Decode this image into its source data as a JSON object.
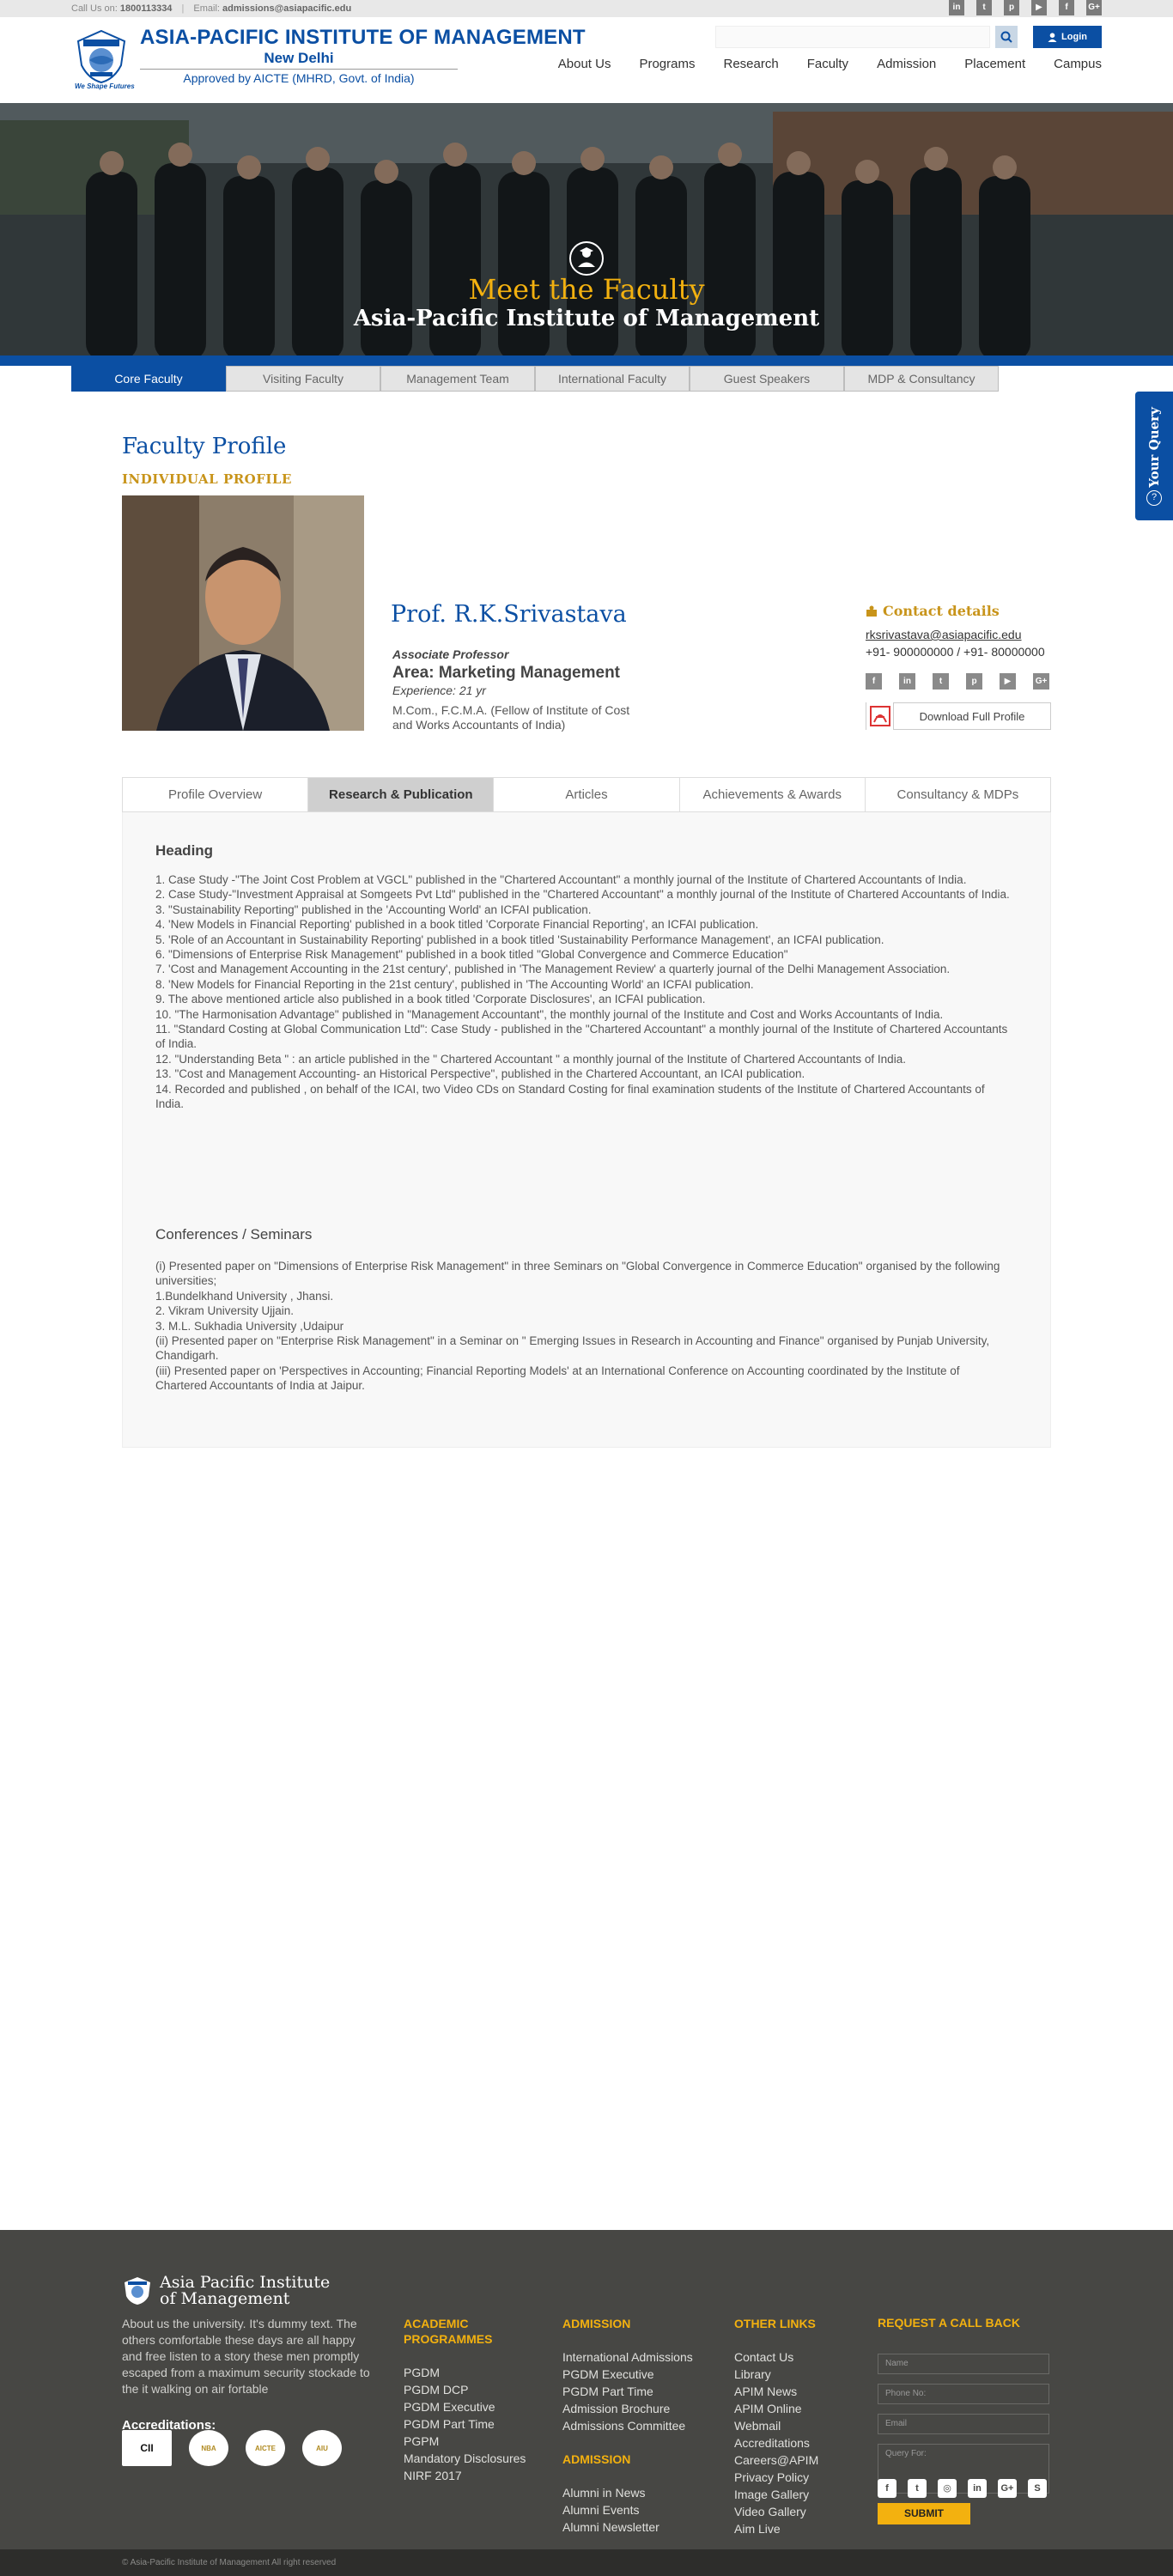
{
  "topbar": {
    "call_label": "Call Us on:",
    "call_number": "1800113334",
    "separator": "|",
    "email_label": "Email:",
    "email": "admissions@asiapacific.edu",
    "social": [
      "in",
      "t",
      "p",
      "yt",
      "f",
      "G+"
    ]
  },
  "header": {
    "title": "ASIA-PACIFIC INSTITUTE OF MANAGEMENT",
    "city": "New Delhi",
    "approved": "Approved by AICTE (MHRD, Govt. of India)",
    "tagline": "We Shape Futures",
    "login": "Login",
    "nav": [
      "About Us",
      "Programs",
      "Research",
      "Faculty",
      "Admission",
      "Placement",
      "Campus"
    ]
  },
  "hero": {
    "title": "Meet the Faculty",
    "subtitle": "Asia-Pacific Institute of Management"
  },
  "faculty_tabs": [
    "Core Faculty",
    "Visiting Faculty",
    "Management Team",
    "International Faculty",
    "Guest Speakers",
    "MDP & Consultancy"
  ],
  "query_label": "Your Query",
  "profile": {
    "heading": "Faculty Profile",
    "subheading": "INDIVIDUAL PROFILE",
    "name": "Prof. R.K.Srivastava",
    "designation": "Associate Professor",
    "area": "Area: Marketing Management",
    "experience": "Experience: 21 yr",
    "qualification": "M.Com., F.C.M.A. (Fellow of Institute of Cost and Works Accountants of India)",
    "contact_heading": "Contact details",
    "email": "rksrivastava@asiapacific.edu",
    "phone": "+91- 900000000 / +91- 80000000",
    "social": [
      "f",
      "in",
      "t",
      "p",
      "yt",
      "G+"
    ],
    "download": "Download Full Profile"
  },
  "profile_tabs": [
    "Profile Overview",
    "Research & Publication",
    "Articles",
    "Achievements & Awards",
    "Consultancy & MDPs"
  ],
  "content": {
    "heading": "Heading",
    "publications": [
      "1. Case Study -\"The Joint Cost Problem at VGCL\" published in the \"Chartered Accountant\" a monthly journal of the Institute of Chartered Accountants of India.",
      "2. Case Study-\"Investment Appraisal at Somgeets Pvt Ltd\" published in the \"Chartered Accountant\" a monthly journal of the Institute of Chartered Accountants of India.",
      "3. \"Sustainability Reporting\" published in the 'Accounting World' an ICFAI publication.",
      "4. 'New Models in Financial Reporting' published in a book titled 'Corporate Financial Reporting', an ICFAI publication.",
      "5. 'Role of an Accountant in Sustainability Reporting' published in a book titled 'Sustainability Performance Management', an ICFAI publication.",
      "6. \"Dimensions of Enterprise Risk Management\" published in a book titled \"Global Convergence and Commerce Education\"",
      "7. 'Cost and Management Accounting in the 21st century', published in 'The Management Review' a quarterly journal of the Delhi Management Association.",
      "8. 'New Models for Financial Reporting in the 21st century', published in 'The Accounting World' an ICFAI publication.",
      "9. The above mentioned article also published in a book titled 'Corporate Disclosures', an ICFAI publication.",
      "10. \"The Harmonisation Advantage\" published in \"Management Accountant\", the monthly journal of the Institute and Cost and Works Accountants of India.",
      "11. \"Standard Costing at Global Communication Ltd\": Case Study - published in the \"Chartered Accountant\" a monthly journal of the Institute of Chartered Accountants of India.",
      "12. \"Understanding Beta \" : an article published in the \" Chartered Accountant \" a monthly journal of the Institute of Chartered Accountants of India.",
      "13. \"Cost and Management Accounting- an Historical Perspective\", published in the Chartered Accountant, an ICAI publication.",
      "14. Recorded and published , on behalf of the ICAI, two Video CDs on Standard Costing for final examination students of the Institute of Chartered Accountants of India."
    ],
    "conferences_heading": "Conferences / Seminars",
    "conferences": [
      "(i) Presented paper on \"Dimensions of Enterprise Risk Management\" in three Seminars on \"Global Convergence in Commerce Education\" organised by the following universities;",
      "1.Bundelkhand University , Jhansi.",
      "2. Vikram University Ujjain.",
      "3. M.L. Sukhadia University ,Udaipur",
      "(ii) Presented paper on \"Enterprise Risk Management\" in a Seminar on \" Emerging Issues in Research in Accounting and Finance\" organised by Punjab University, Chandigarh.",
      "(iii) Presented paper on 'Perspectives in Accounting; Financial Reporting Models' at an International Conference on Accounting coordinated by the Institute of Chartered Accountants of India at Jaipur."
    ]
  },
  "footer": {
    "logo_line1": "Asia Pacific Institute",
    "logo_line2": "of Management",
    "about": "About us the university. It's dummy text. The others comfortable these days are all happy and free listen to a story these men promptly escaped from a maximum security stockade to the it walking on air fortable",
    "accreditations_label": "Accreditations:",
    "accreditations": [
      "CII",
      "NBA",
      "AICTE",
      "AIU"
    ],
    "academic_heading": "ACADEMIC PROGRAMMES",
    "academic": [
      "PGDM",
      "PGDM DCP",
      "PGDM Executive",
      "PGDM Part Time",
      "PGPM",
      "Mandatory Disclosures",
      "NIRF 2017"
    ],
    "admission_heading": "ADMISSION",
    "admission": [
      "International Admissions",
      "PGDM Executive",
      "PGDM Part Time",
      "Admission Brochure",
      "Admissions Committee"
    ],
    "admission2_heading": "ADMISSION",
    "admission2": [
      "Alumni in News",
      "Alumni Events",
      "Alumni Newsletter"
    ],
    "other_heading": "OTHER LINKS",
    "other": [
      "Contact Us",
      "Library",
      "APIM News",
      "APIM Online",
      "Webmail",
      "Accreditations",
      "Careers@APIM",
      "Privacy Policy",
      "Image Gallery",
      "Video Gallery",
      "Aim Live"
    ],
    "request_heading": "REQUEST A CALL BACK",
    "placeholders": {
      "name": "Name",
      "phone": "Phone No:",
      "email": "Email",
      "query": "Query For:"
    },
    "submit": "SUBMIT",
    "social": [
      "f",
      "t",
      "ig",
      "in",
      "G+",
      "S"
    ],
    "copyright": "© Asia-Pacific Institute of Management All right reserved"
  }
}
